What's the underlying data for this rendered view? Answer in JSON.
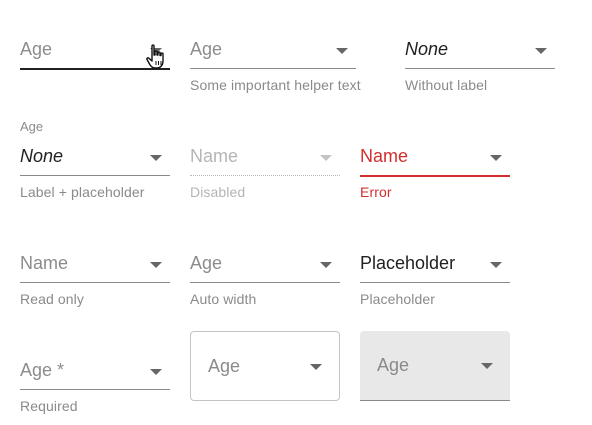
{
  "fields": {
    "age_focused": {
      "value": "Age"
    },
    "age_helper": {
      "value": "Age",
      "helper": "Some important helper text"
    },
    "without_label": {
      "value": "None",
      "helper": "Without label"
    },
    "label_placeholder": {
      "label": "Age",
      "value": "None",
      "helper": "Label + placeholder"
    },
    "disabled": {
      "value": "Name",
      "helper": "Disabled"
    },
    "error": {
      "value": "Name",
      "helper": "Error"
    },
    "read_only": {
      "value": "Name",
      "helper": "Read only"
    },
    "auto_width": {
      "value": "Age",
      "helper": "Auto width"
    },
    "placeholder": {
      "value": "Placeholder",
      "helper": "Placeholder"
    },
    "required": {
      "value": "Age *",
      "helper": "Required"
    },
    "outlined": {
      "value": "Age"
    },
    "filled": {
      "value": "Age"
    }
  },
  "colors": {
    "error": "#d32f2f",
    "text": "#212121",
    "muted": "#8a8a8a",
    "filled_bg": "#e8e8e8"
  },
  "icons": {
    "dropdown": "caret-down-icon",
    "cursor": "hand-pointer-cursor-icon"
  }
}
